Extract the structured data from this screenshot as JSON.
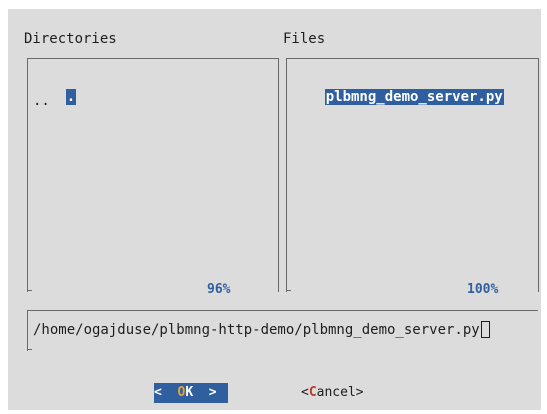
{
  "dialog": {
    "directories_label": "Directories",
    "files_label": "Files",
    "directories": [
      ".",
      ".."
    ],
    "files": [
      "plbmng_demo_server.py"
    ],
    "directories_percent": "96%",
    "files_percent": "100%",
    "path_value": "/home/ogajduse/plbmng-http-demo/plbmng_demo_server.py",
    "ok_button": {
      "left": "<",
      "hotkey": "O",
      "rest": "K",
      "right": ">"
    },
    "cancel_button": {
      "left": "<",
      "hotkey": "C",
      "rest": "ancel",
      "right": ">"
    }
  },
  "colors": {
    "dialog_bg": "#dcdcdc",
    "selection_bg": "#2f5f9e",
    "selection_fg": "#ffffff",
    "hotkey_ok": "#e6a23c",
    "hotkey_cancel": "#c0392b"
  }
}
